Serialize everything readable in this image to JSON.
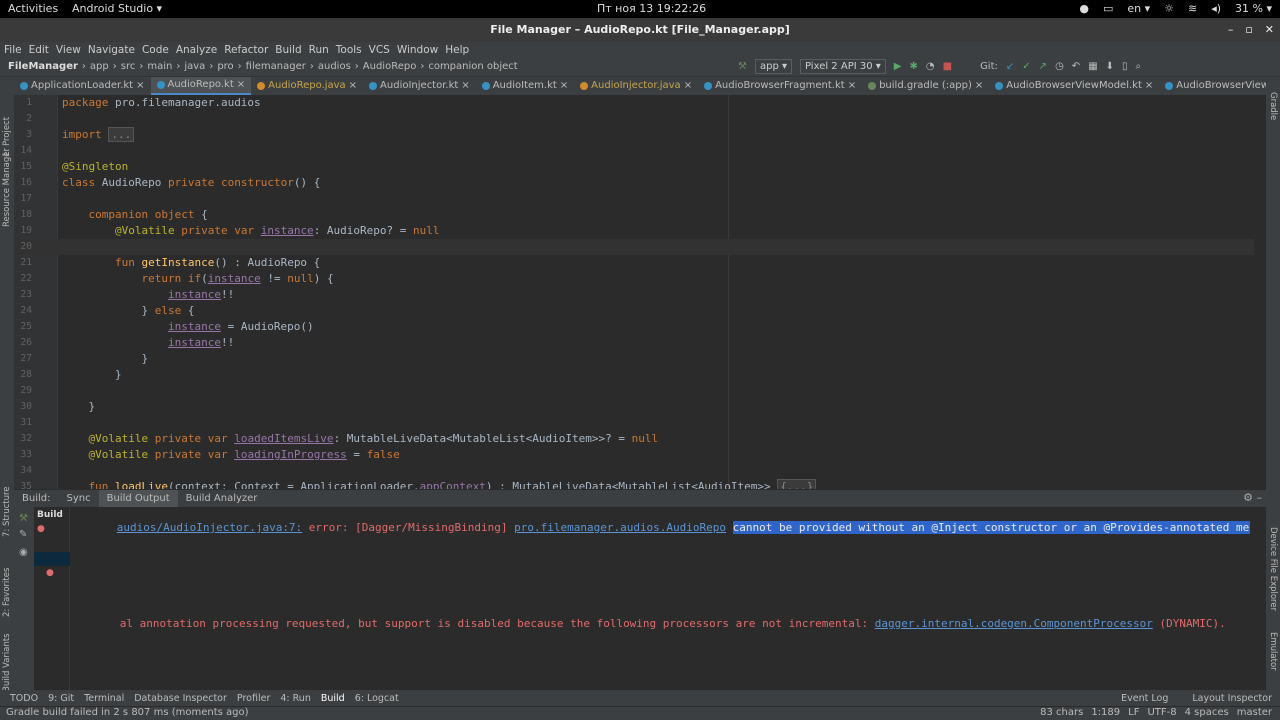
{
  "gnome": {
    "activities": "Activities",
    "app": "Android Studio ▾",
    "clock": "Пт ноя 13  19:22:26",
    "lang": "en ▾",
    "battery": "31 % ▾"
  },
  "window": {
    "title": "File Manager – AudioRepo.kt [File_Manager.app]"
  },
  "menu": [
    "File",
    "Edit",
    "View",
    "Navigate",
    "Code",
    "Analyze",
    "Refactor",
    "Build",
    "Run",
    "Tools",
    "VCS",
    "Window",
    "Help"
  ],
  "breadcrumbs": [
    "FileManager",
    "app",
    "src",
    "main",
    "java",
    "pro",
    "filemanager",
    "audios",
    "AudioRepo",
    "companion object"
  ],
  "toolbar": {
    "config": "app ▾",
    "device": "Pixel 2 API 30 ▾",
    "git": "Git:"
  },
  "tabs": [
    {
      "label": "ApplicationLoader.kt",
      "type": "k"
    },
    {
      "label": "AudioRepo.kt",
      "type": "k",
      "active": true
    },
    {
      "label": "AudioRepo.java",
      "type": "j"
    },
    {
      "label": "AudioInjector.kt",
      "type": "k"
    },
    {
      "label": "AudioItem.kt",
      "type": "k"
    },
    {
      "label": "AudioInjector.java",
      "type": "j"
    },
    {
      "label": "AudioBrowserFragment.kt",
      "type": "k"
    },
    {
      "label": "build.gradle (:app)",
      "type": "g"
    },
    {
      "label": "AudioBrowserViewModel.kt",
      "type": "k"
    },
    {
      "label": "AudioBrowserViewModelFa",
      "type": "k"
    }
  ],
  "leftstrip": [
    "1: Project",
    "Resource Manager",
    "7: Structure",
    "2: Favorites",
    "Build Variants"
  ],
  "rightstrip": [
    "Gradle",
    "Device File Explorer",
    "Emulator"
  ],
  "code": [
    {
      "n": "1",
      "html": "<span class='kw'>package</span> pro.filemanager.audios"
    },
    {
      "n": "2",
      "html": ""
    },
    {
      "n": "3",
      "html": "<span class='kw'>import</span> <span class='fold'>...</span>"
    },
    {
      "n": "14",
      "html": ""
    },
    {
      "n": "15",
      "html": "<span class='an'>@Singleton</span>"
    },
    {
      "n": "16",
      "html": "<span class='kw'>class</span> AudioRepo <span class='kw'>private constructor</span>() {"
    },
    {
      "n": "17",
      "html": ""
    },
    {
      "n": "18",
      "html": "    <span class='kw'>companion object</span> {"
    },
    {
      "n": "19",
      "html": "        <span class='an'>@Volatile</span> <span class='kw'>private var</span> <span class='pr'>instance</span>: AudioRepo? = <span class='kw'>null</span>"
    },
    {
      "n": "20",
      "html": "",
      "cur": true
    },
    {
      "n": "21",
      "html": "        <span class='kw'>fun</span> <span class='fn'>getInstance</span>() : AudioRepo {"
    },
    {
      "n": "22",
      "html": "            <span class='kw'>return if</span>(<span class='pr'>instance</span> != <span class='kw'>null</span>) {"
    },
    {
      "n": "23",
      "html": "                <span class='pr'>instance</span>!!"
    },
    {
      "n": "24",
      "html": "            } <span class='kw'>else</span> {"
    },
    {
      "n": "25",
      "html": "                <span class='pr'>instance</span> = AudioRepo()"
    },
    {
      "n": "26",
      "html": "                <span class='pr'>instance</span>!!"
    },
    {
      "n": "27",
      "html": "            }"
    },
    {
      "n": "28",
      "html": "        }"
    },
    {
      "n": "29",
      "html": ""
    },
    {
      "n": "30",
      "html": "    }"
    },
    {
      "n": "31",
      "html": ""
    },
    {
      "n": "32",
      "html": "    <span class='an'>@Volatile</span> <span class='kw'>private var</span> <span class='pr'>loadedItemsLive</span>: MutableLiveData&lt;MutableList&lt;AudioItem&gt;&gt;? = <span class='kw'>null</span>"
    },
    {
      "n": "33",
      "html": "    <span class='an'>@Volatile</span> <span class='kw'>private var</span> <span class='pr'>loadingInProgress</span> = <span class='kw'>false</span>"
    },
    {
      "n": "34",
      "html": ""
    },
    {
      "n": "35",
      "html": "    <span class='kw'>fun</span> <span class='fn'>loadLive</span>(context: Context = ApplicationLoader.<span class='pr'>appContext</span>) : MutableLiveData&lt;MutableList&lt;AudioItem&gt;&gt; <span class='fold'>{...}</span>"
    }
  ],
  "build": {
    "tabs": [
      "Build:",
      "Sync",
      "Build Output",
      "Build Analyzer"
    ],
    "tree_label": "Build",
    "err1_path": "audios/AudioInjector.java:7:",
    "err1_mid": " error: [Dagger/MissingBinding] ",
    "err1_link": "pro.filemanager.audios.AudioRepo",
    "err1_sel": "cannot be provided without an @Inject constructor or an @Provides-annotated method.",
    "warn_text": "al annotation processing requested, but support is disabled because the following processors are not incremental: ",
    "warn_link": "dagger.internal.codegen.ComponentProcessor",
    "warn_tail": " (DYNAMIC)."
  },
  "bottomtabs": [
    "TODO",
    "9: Git",
    "Terminal",
    "Database Inspector",
    "Profiler",
    "4: Run",
    "Build",
    "6: Logcat"
  ],
  "bottomright": [
    "Event Log",
    "Layout Inspector"
  ],
  "status": {
    "message": "Gradle build failed in 2 s 807 ms (moments ago)",
    "chars": "83 chars",
    "pos": "1:189",
    "lf": "LF",
    "enc": "UTF-8",
    "indent": "4 spaces",
    "branch": "master"
  }
}
